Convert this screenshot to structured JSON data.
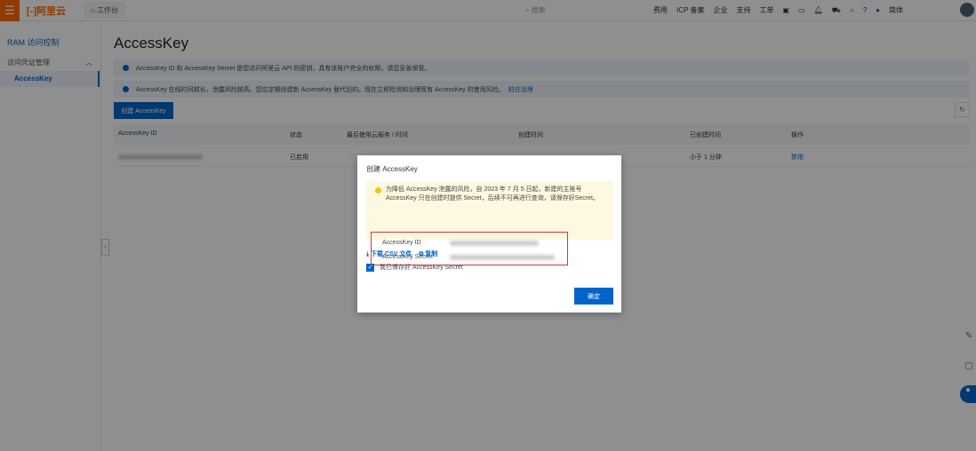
{
  "topbar": {
    "logo": "[-]阿里云",
    "workspace": "工作台",
    "search_placeholder": "搜索",
    "nav": [
      "费用",
      "ICP 备案",
      "企业",
      "支持",
      "工单"
    ],
    "lang": "简体"
  },
  "sidebar": {
    "title": "RAM 访问控制",
    "group": "访问凭证管理",
    "active": "AccessKey"
  },
  "page": {
    "title": "AccessKey",
    "alert1": "AccessKey ID 和 AccessKey Secret 是您访问阿里云 API 的密钥，具有该账户完全的权限，请您妥善保管。",
    "alert2": "AccessKey 在线时间越长，泄露风险越高。您应定期创建新 AccessKey 替代旧的。现在立即检测和治理现有 AccessKey 的使用风险。",
    "alert2_link": "前往治理",
    "create_button": "创建 AccessKey",
    "table": {
      "headers": [
        "AccessKey ID",
        "状态",
        "最后使用云服务 / 时间",
        "创建时间",
        "已创建时间",
        "操作"
      ],
      "rows": [
        {
          "status": "已启用",
          "age": "小于 1 分钟",
          "action": "禁用"
        }
      ]
    }
  },
  "modal": {
    "title": "创建 AccessKey",
    "warning": "为降低 AccessKey 泄露的风险，自 2023 年 7 月 5 日起，新建的主账号 AccessKey 只在创建时提供 Secret，后续不可再进行查询，请保存好Secret。",
    "id_label": "AccessKey ID",
    "secret_label": "AccessKey Secret",
    "download": "下载 CSV 文件",
    "copy": "复制",
    "checkbox_label": "我已保存好 AccessKey Secret",
    "checked": true,
    "ok": "确定"
  }
}
